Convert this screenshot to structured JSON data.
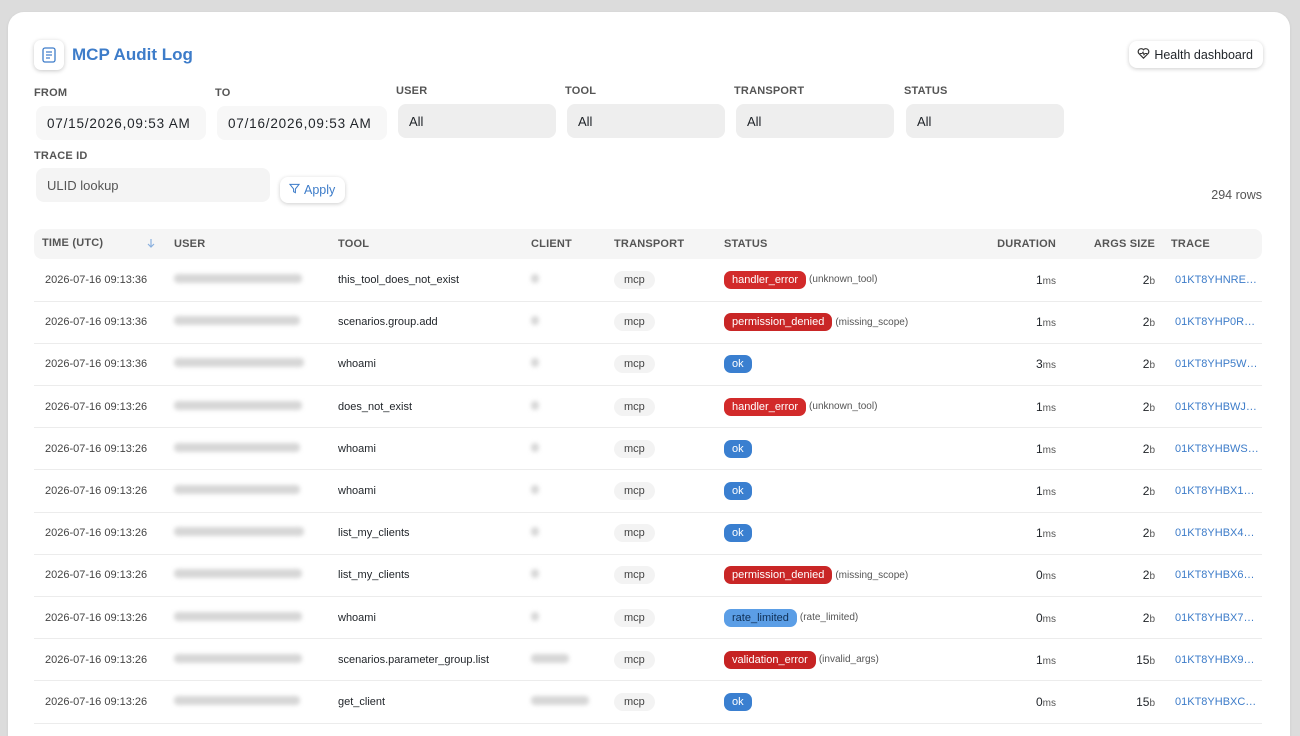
{
  "header": {
    "title": "MCP Audit Log",
    "title_icon": "document-list-icon",
    "health_button": "Health dashboard",
    "health_icon": "heart-pulse-icon"
  },
  "filters": {
    "from_label": "FROM",
    "from_value": "07/15/2026,09:53 AM",
    "to_label": "TO",
    "to_value": "07/16/2026,09:53 AM",
    "user_label": "USER",
    "user_value": "All",
    "tool_label": "TOOL",
    "tool_value": "All",
    "transport_label": "TRANSPORT",
    "transport_value": "All",
    "status_label": "STATUS",
    "status_value": "All",
    "trace_label": "TRACE ID",
    "trace_placeholder": "ULID lookup",
    "apply_label": "Apply",
    "apply_icon": "filter-icon"
  },
  "row_count": "294 rows",
  "table": {
    "columns": {
      "time": "TIME (UTC)",
      "user": "USER",
      "tool": "TOOL",
      "client": "CLIENT",
      "transport": "TRANSPORT",
      "status": "STATUS",
      "duration": "DURATION",
      "args_size": "ARGS SIZE",
      "trace": "TRACE"
    },
    "sort_icon": "arrow-down-icon",
    "rows": [
      {
        "time": "2026-07-16 09:13:36",
        "tool": "this_tool_does_not_exist",
        "transport": "mcp",
        "status": "handler_error",
        "reason": "(unknown_tool)",
        "duration": "1",
        "duration_unit": "ms",
        "args": "2",
        "args_unit": "b",
        "trace": "01KT8YHNRE…"
      },
      {
        "time": "2026-07-16 09:13:36",
        "tool": "scenarios.group.add",
        "transport": "mcp",
        "status": "permission_denied",
        "reason": "(missing_scope)",
        "duration": "1",
        "duration_unit": "ms",
        "args": "2",
        "args_unit": "b",
        "trace": "01KT8YHP0R…"
      },
      {
        "time": "2026-07-16 09:13:36",
        "tool": "whoami",
        "transport": "mcp",
        "status": "ok",
        "reason": "",
        "duration": "3",
        "duration_unit": "ms",
        "args": "2",
        "args_unit": "b",
        "trace": "01KT8YHP5W…"
      },
      {
        "time": "2026-07-16 09:13:26",
        "tool": "does_not_exist",
        "transport": "mcp",
        "status": "handler_error",
        "reason": "(unknown_tool)",
        "duration": "1",
        "duration_unit": "ms",
        "args": "2",
        "args_unit": "b",
        "trace": "01KT8YHBWJ…"
      },
      {
        "time": "2026-07-16 09:13:26",
        "tool": "whoami",
        "transport": "mcp",
        "status": "ok",
        "reason": "",
        "duration": "1",
        "duration_unit": "ms",
        "args": "2",
        "args_unit": "b",
        "trace": "01KT8YHBWS…"
      },
      {
        "time": "2026-07-16 09:13:26",
        "tool": "whoami",
        "transport": "mcp",
        "status": "ok",
        "reason": "",
        "duration": "1",
        "duration_unit": "ms",
        "args": "2",
        "args_unit": "b",
        "trace": "01KT8YHBX1…"
      },
      {
        "time": "2026-07-16 09:13:26",
        "tool": "list_my_clients",
        "transport": "mcp",
        "status": "ok",
        "reason": "",
        "duration": "1",
        "duration_unit": "ms",
        "args": "2",
        "args_unit": "b",
        "trace": "01KT8YHBX4…"
      },
      {
        "time": "2026-07-16 09:13:26",
        "tool": "list_my_clients",
        "transport": "mcp",
        "status": "permission_denied",
        "reason": "(missing_scope)",
        "duration": "0",
        "duration_unit": "ms",
        "args": "2",
        "args_unit": "b",
        "trace": "01KT8YHBX6…"
      },
      {
        "time": "2026-07-16 09:13:26",
        "tool": "whoami",
        "transport": "mcp",
        "status": "rate_limited",
        "reason": "(rate_limited)",
        "duration": "0",
        "duration_unit": "ms",
        "args": "2",
        "args_unit": "b",
        "trace": "01KT8YHBX7…"
      },
      {
        "time": "2026-07-16 09:13:26",
        "tool": "scenarios.parameter_group.list",
        "transport": "mcp",
        "status": "validation_error",
        "reason": "(invalid_args)",
        "duration": "1",
        "duration_unit": "ms",
        "args": "15",
        "args_unit": "b",
        "trace": "01KT8YHBX9…"
      },
      {
        "time": "2026-07-16 09:13:26",
        "tool": "get_client",
        "transport": "mcp",
        "status": "ok",
        "reason": "",
        "duration": "0",
        "duration_unit": "ms",
        "args": "15",
        "args_unit": "b",
        "trace": "01KT8YHBXC…"
      }
    ]
  },
  "colors": {
    "accent": "#3d7cc9",
    "ok": "#3a7fd0",
    "error": "#d22a2a",
    "rate_limited": "#5b9ee6"
  }
}
